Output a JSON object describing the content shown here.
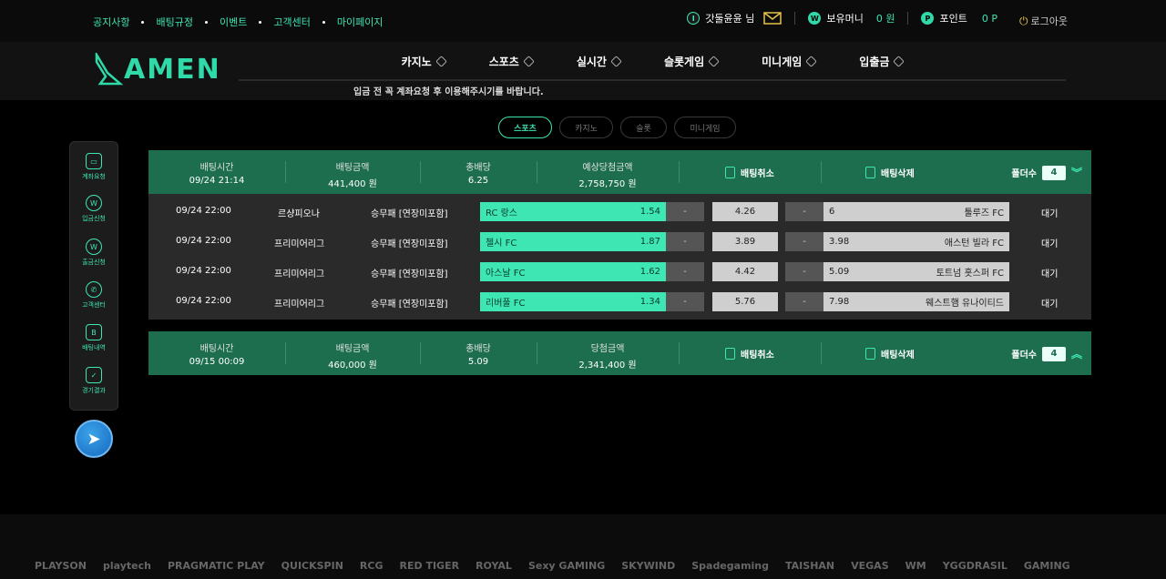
{
  "top_links": [
    "공지사항",
    "배팅규정",
    "이벤트",
    "고객센터",
    "마이페이지"
  ],
  "user": {
    "name": "갓둘윤윤 님",
    "money_label": "보유머니",
    "money": "0 원",
    "point_label": "포인트",
    "point": "0 P",
    "logout": "로그아웃"
  },
  "logo": "AMEN",
  "nav": [
    "카지노",
    "스포츠",
    "실시간",
    "슬롯게임",
    "미니게임",
    "입출금"
  ],
  "notice": "입금 전 꼭 계좌요청 후 이용해주시기를 바랍니다.",
  "tabs": [
    "스포츠",
    "카지노",
    "슬롯",
    "미니게임"
  ],
  "sidebar": [
    "계좌요청",
    "입금신청",
    "출금신청",
    "고객센터",
    "배팅내역",
    "경기결과"
  ],
  "bets": [
    {
      "time_label": "배팅시간",
      "time": "09/24 21:14",
      "amount_label": "배팅금액",
      "amount": "441,400 원",
      "odds_label": "총배당",
      "odds": "6.25",
      "win_label": "예상당첨금액",
      "win": "2,758,750 원",
      "cancel": "배팅취소",
      "delete": "배팅삭제",
      "fold_label": "폴더수",
      "folds": "4",
      "rows": [
        {
          "date": "09/24 22:00",
          "league": "르샹피오나",
          "market": "승무패 [연장미포함]",
          "home": "RC 랑스",
          "home_odds": "1.54",
          "dash": "-",
          "draw": "4.26",
          "away_odds": "6",
          "away": "툴루즈 FC",
          "status": "대기"
        },
        {
          "date": "09/24 22:00",
          "league": "프리미어리그",
          "market": "승무패 [연장미포함]",
          "home": "첼시 FC",
          "home_odds": "1.87",
          "dash": "-",
          "draw": "3.89",
          "away_odds": "3.98",
          "away": "애스턴 빌라 FC",
          "status": "대기"
        },
        {
          "date": "09/24 22:00",
          "league": "프리미어리그",
          "market": "승무패 [연장미포함]",
          "home": "아스날 FC",
          "home_odds": "1.62",
          "dash": "-",
          "draw": "4.42",
          "away_odds": "5.09",
          "away": "토트넘 홋스퍼 FC",
          "status": "대기"
        },
        {
          "date": "09/24 22:00",
          "league": "프리미어리그",
          "market": "승무패 [연장미포함]",
          "home": "리버풀 FC",
          "home_odds": "1.34",
          "dash": "-",
          "draw": "5.76",
          "away_odds": "7.98",
          "away": "웨스트햄 유나이티드",
          "status": "대기"
        }
      ]
    },
    {
      "time_label": "배팅시간",
      "time": "09/15 00:09",
      "amount_label": "배팅금액",
      "amount": "460,000 원",
      "odds_label": "총배당",
      "odds": "5.09",
      "win_label": "당첨금액",
      "win": "2,341,400 원",
      "cancel": "배팅취소",
      "delete": "배팅삭제",
      "fold_label": "폴더수",
      "folds": "4"
    }
  ],
  "providers": [
    "PLAYSON",
    "playtech",
    "PRAGMATIC PLAY",
    "QUICKSPIN",
    "RCG",
    "RED TIGER",
    "ROYAL",
    "Sexy GAMING",
    "SKYWIND",
    "Spadegaming",
    "TAISHAN",
    "VEGAS",
    "WM",
    "YGGDRASIL",
    "GAMING"
  ],
  "colors": {
    "accent": "#3ee6b4",
    "panel": "#1d6e4f"
  }
}
